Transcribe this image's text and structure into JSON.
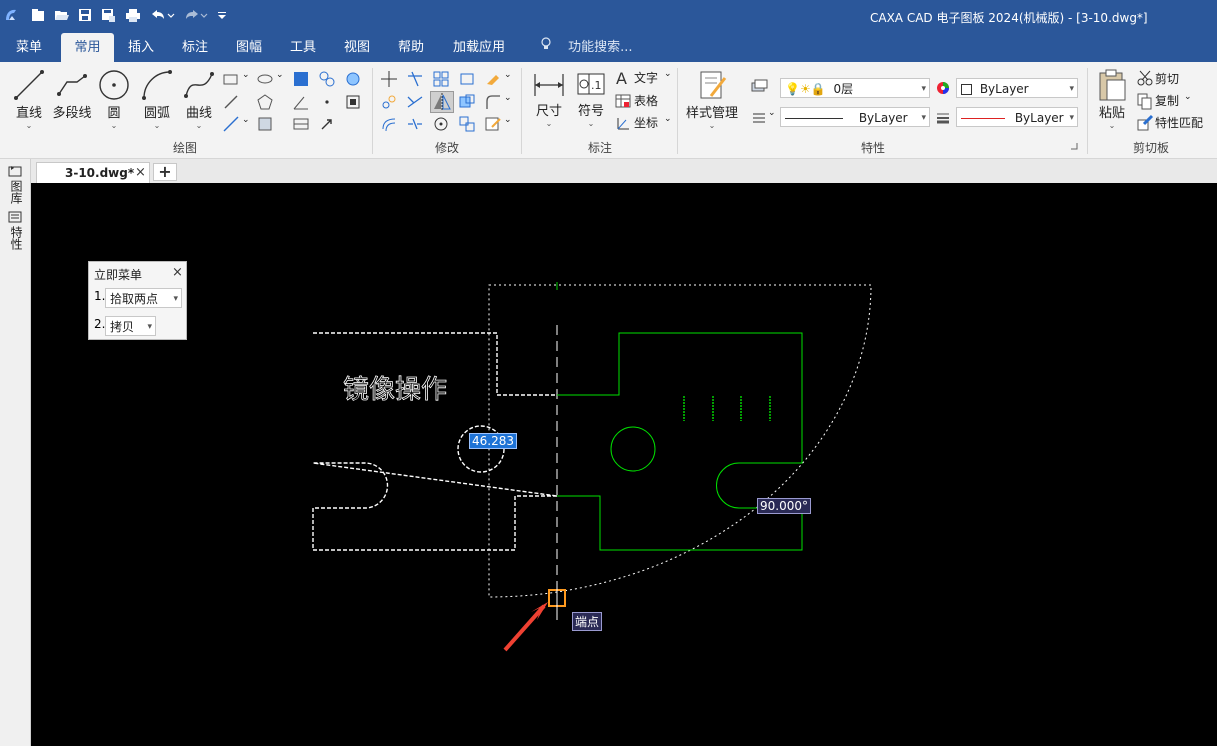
{
  "title_bar": {
    "app_title": "CAXA CAD 电子图板 2024(机械版) - [3-10.dwg*]",
    "quick_access": [
      "logo-icon",
      "new-file-icon",
      "open-file-icon",
      "save-icon",
      "save-as-icon",
      "print-icon",
      "undo-icon",
      "redo-icon",
      "customize-icon"
    ]
  },
  "menu_tabs": [
    "菜单",
    "常用",
    "插入",
    "标注",
    "图幅",
    "工具",
    "视图",
    "帮助",
    "加载应用"
  ],
  "active_tab": "常用",
  "search_placeholder": "功能搜索...",
  "ribbon": {
    "draw": {
      "label": "绘图",
      "big_buttons": [
        "直线",
        "多段线",
        "圆",
        "圆弧",
        "曲线"
      ]
    },
    "modify": {
      "label": "修改"
    },
    "annotate": {
      "label": "标注",
      "buttons": [
        "尺寸",
        "符号"
      ],
      "text_items": [
        "文字",
        "表格",
        "坐标"
      ]
    },
    "properties": {
      "label": "特性",
      "style_manage": "样式管理",
      "layer_value": "0层",
      "color_value": "ByLayer",
      "linetype_value": "ByLayer",
      "lineweight_value": "ByLayer"
    },
    "clipboard": {
      "label": "剪切板",
      "paste": "粘贴",
      "cut": "剪切",
      "copy": "复制",
      "match_props": "特性匹配"
    }
  },
  "doc_tab": {
    "name": "3-10.dwg*",
    "close": "×",
    "add": "+"
  },
  "side_panel": [
    "图库",
    "特性"
  ],
  "immediate_menu": {
    "title": "立即菜单",
    "close": "×",
    "rows": [
      {
        "num": "1.",
        "value": "拾取两点"
      },
      {
        "num": "2.",
        "value": "拷贝"
      }
    ]
  },
  "drawing": {
    "text": "镜像操作",
    "dim_radius": "46.283",
    "dim_angle": "90.000°",
    "snap_label": "端点"
  },
  "colors": {
    "title_blue": "#2b579a",
    "canvas": "#000000",
    "green": "#00e000",
    "selection_white": "#ffffff",
    "dim_highlight": "#1e73d6",
    "snap_orange": "#ff9a1f",
    "arrow_red": "#ef4132"
  }
}
